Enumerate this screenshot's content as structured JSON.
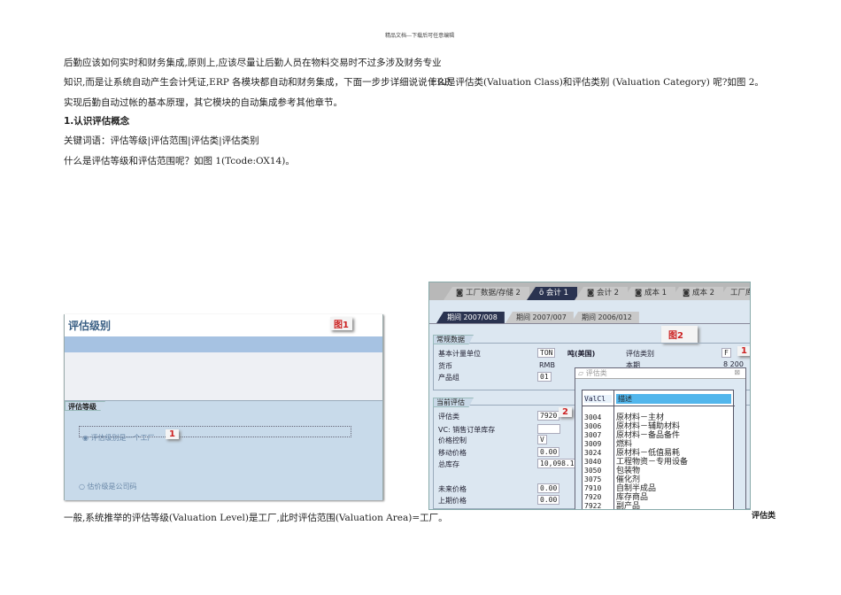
{
  "header": "精品文档---下载后可任意编辑",
  "left_text": {
    "p1": [
      "后勤应该如何实时和财务集成,原则上,应该尽量让后勤人员在物料交易时不过多涉及财务专业",
      "知识,而是让系统自动产生会计凭证,ERP 各模块都自动和财务集成，下面一步步详细说说 ERP",
      "实现后勤自动过帐的基本原理，其它模块的自动集成参考其他章节。"
    ],
    "heading": "1.认识评估概念",
    "keywords": "关键词语：评估等级|评估范围|评估类|评估类别",
    "question": "什么是评估等级和评估范围呢？如图 1(Tcode:OX14)。",
    "caption": "一般,系统推举的评估等级(Valuation Level)是工厂,此时评估范围(Valuation Area)=工厂。"
  },
  "right_text": {
    "question": "什么是评估类(Valuation Class)和评估类别 (Valuation Category) 呢?如图 2。",
    "caption": "评估类"
  },
  "fig1": {
    "title": "评估级别",
    "tag": "图1",
    "section": "评估等级",
    "option1": "评估级别是一个工厂",
    "option2": "估价级是公司码",
    "marker": "1"
  },
  "fig2": {
    "tabs": [
      "工厂数据/存储 2",
      "会计 1",
      "会计 2",
      "成本 1",
      "成本 2",
      "工厂库"
    ],
    "period_tabs": [
      "期间 2007/008",
      "期间 2007/007",
      "期间 2006/012"
    ],
    "tag": "图2",
    "general": {
      "title": "常规数据",
      "rows": [
        {
          "label": "基本计量单位",
          "value": "TON",
          "extra": "吨(美国)"
        },
        {
          "label": "货币",
          "value": "RMB"
        },
        {
          "label": "产品组",
          "value": "01"
        }
      ],
      "cat_label": "评估类别",
      "cat_value": "F",
      "cat_marker": "1",
      "period_label": "本期",
      "period_value": "8  200"
    },
    "current": {
      "title": "当前评估",
      "rows": [
        {
          "label": "评估类",
          "value": "7920"
        },
        {
          "label": "VC: 销售订单库存",
          "value": ""
        },
        {
          "label": "价格控制",
          "value": "V"
        },
        {
          "label": "移动价格",
          "value": "0.00"
        },
        {
          "label": "总库存",
          "value": "10,098.1"
        },
        {
          "label": "未来价格",
          "value": "0.00"
        },
        {
          "label": "上期价格",
          "value": "0.00"
        }
      ],
      "marker": "2"
    },
    "popup": {
      "title": "评估类",
      "col1": "ValCl",
      "col2": "描述",
      "rows": [
        [
          "3004",
          "原材料－主材"
        ],
        [
          "3006",
          "原材料－辅助材料"
        ],
        [
          "3007",
          "原材料－备品备件"
        ],
        [
          "3009",
          "燃料"
        ],
        [
          "3024",
          "原材料－低值易耗"
        ],
        [
          "3040",
          "工程物资－专用设备"
        ],
        [
          "3050",
          "包装物"
        ],
        [
          "3075",
          "催化剂"
        ],
        [
          "7910",
          "自制半成品"
        ],
        [
          "7920",
          "库存商品"
        ],
        [
          "7922",
          "副产品"
        ]
      ]
    }
  }
}
